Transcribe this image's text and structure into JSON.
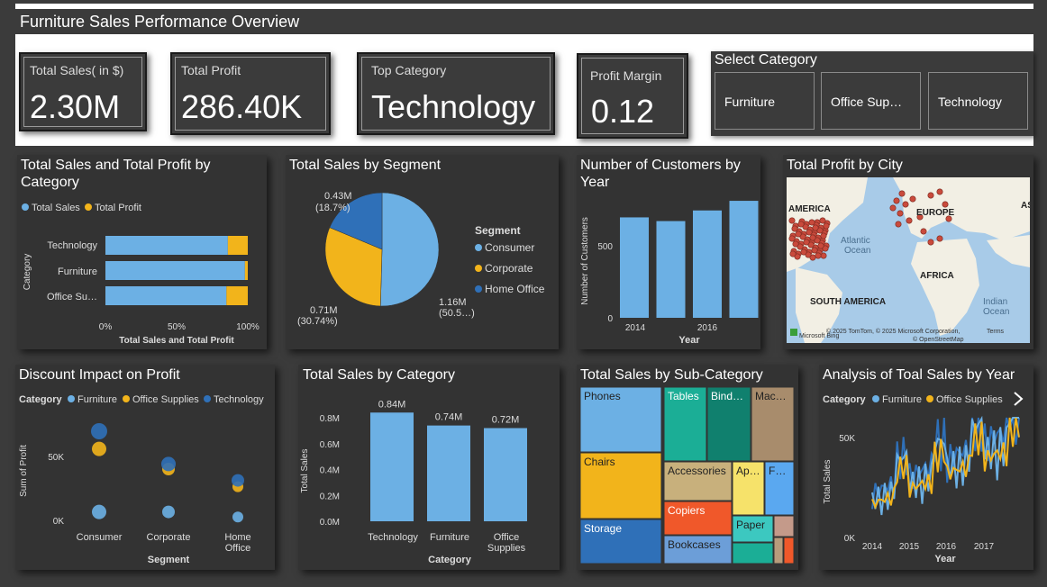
{
  "header": {
    "title": "Furniture Sales Performance Overview"
  },
  "kpis": {
    "total_sales": {
      "label": "Total Sales( in $)",
      "value": "2.30M"
    },
    "total_profit": {
      "label": "Total Profit",
      "value": "286.40K"
    },
    "top_category": {
      "label": "Top Category",
      "value": "Technology"
    },
    "profit_margin": {
      "label": "Profit Margin",
      "value": "0.12"
    }
  },
  "slicer": {
    "title": "Select Category",
    "options": [
      "Furniture",
      "Office Sup…",
      "Technology"
    ]
  },
  "colors": {
    "light_blue": "#6cb0e4",
    "gold": "#f2b41b",
    "dark_blue": "#2f70b8",
    "bg": "#3b3b3b"
  },
  "panels": {
    "sales_profit_category": {
      "title": "Total Sales and Total Profit by Category",
      "legend": [
        "Total Sales",
        "Total Profit"
      ],
      "ylabel": "Category",
      "xlabel": "Total Sales and Total Profit",
      "categories": [
        "Technology",
        "Furniture",
        "Office Su…"
      ],
      "ticks": [
        "0%",
        "50%",
        "100%"
      ]
    },
    "segment_pie": {
      "title": "Total Sales by Segment",
      "legend_title": "Segment",
      "legend": [
        "Consumer",
        "Corporate",
        "Home Office"
      ],
      "labels": {
        "consumer": "1.16M",
        "consumer_pct": "(50.5…)",
        "corporate": "0.71M",
        "corporate_pct": "(30.74%)",
        "home": "0.43M",
        "home_pct": "(18.7%)"
      }
    },
    "customers_year": {
      "title": "Number of Customers by Year",
      "ylabel": "Number of Customers",
      "xlabel": "Year",
      "yticks": [
        "0",
        "500"
      ],
      "xticks": [
        "2014",
        "2016"
      ]
    },
    "profit_city": {
      "title": "Total Profit by City",
      "labels": {
        "america": "AMERICA",
        "europe": "EUROPE",
        "as": "AS",
        "atlantic": "Atlantic",
        "ocean": "Ocean",
        "africa": "AFRICA",
        "south_america": "SOUTH AMERICA",
        "indian": "Indian",
        "ocean2": "Ocean"
      },
      "attribution": "© 2025 TomTom, © 2025 Microsoft Corporation,",
      "osm": "© OpenStreetMap",
      "terms": "Terms",
      "bing": "Microsoft Bing"
    },
    "discount": {
      "title": "Discount Impact on Profit",
      "legend_title": "Category",
      "legend": [
        "Furniture",
        "Office Supplies",
        "Technology"
      ],
      "ylabel": "Sum of Profit",
      "xlabel": "Segment",
      "yticks": [
        "0K",
        "50K"
      ],
      "xticks": [
        "Consumer",
        "Corporate",
        "Home",
        "Office"
      ]
    },
    "sales_category": {
      "title": "Total Sales by Category",
      "ylabel": "Total Sales",
      "xlabel": "Category",
      "yticks": [
        "0.0M",
        "0.2M",
        "0.4M",
        "0.6M",
        "0.8M"
      ],
      "xticks": [
        "Technology",
        "Furniture",
        "Office",
        "Supplies"
      ]
    },
    "subcategory": {
      "title": "Total Sales by Sub-Category",
      "tiles": [
        "Phones",
        "Tables",
        "Bind…",
        "Mac…",
        "Chairs",
        "Accessories",
        "Ap…",
        "F…",
        "Storage",
        "Copiers",
        "Paper",
        "Bookcases"
      ]
    },
    "year_analysis": {
      "title": "Analysis of Toal Sales by Year",
      "legend_title": "Category",
      "legend": [
        "Furniture",
        "Office Supplies"
      ],
      "ylabel": "Total Sales",
      "xlabel": "Year",
      "yticks": [
        "0K",
        "50K"
      ],
      "xticks": [
        "2014",
        "2015",
        "2016",
        "2017"
      ]
    }
  },
  "chart_data": [
    {
      "type": "bar",
      "title": "Total Sales and Total Profit by Category",
      "categories": [
        "Technology",
        "Furniture",
        "Office Su…"
      ],
      "series": [
        {
          "name": "Total Sales",
          "values": [
            86,
            98,
            85
          ]
        },
        {
          "name": "Total Profit",
          "values": [
            14,
            2,
            15
          ]
        }
      ],
      "xlabel": "Total Sales and Total Profit",
      "ylabel": "Category",
      "xlim": [
        0,
        100
      ]
    },
    {
      "type": "pie",
      "title": "Total Sales by Segment",
      "categories": [
        "Consumer",
        "Corporate",
        "Home Office"
      ],
      "values": [
        1.16,
        0.71,
        0.43
      ]
    },
    {
      "type": "bar",
      "title": "Number of Customers by Year",
      "categories": [
        "2014",
        "2015",
        "2016",
        "2017"
      ],
      "values": [
        595,
        573,
        636,
        693
      ],
      "ylabel": "Number of Customers",
      "xlabel": "Year"
    },
    {
      "type": "scatter",
      "title": "Discount Impact on Profit",
      "categories": [
        "Consumer",
        "Corporate",
        "Home Office"
      ],
      "series": [
        {
          "name": "Furniture",
          "values": [
            6,
            6,
            2
          ]
        },
        {
          "name": "Office Supplies",
          "values": [
            56,
            40,
            26
          ]
        },
        {
          "name": "Technology",
          "values": [
            70,
            44,
            31
          ]
        }
      ],
      "ylabel": "Sum of Profit",
      "xlabel": "Segment"
    },
    {
      "type": "bar",
      "title": "Total Sales by Category",
      "categories": [
        "Technology",
        "Furniture",
        "Office Supplies"
      ],
      "values": [
        0.84,
        0.74,
        0.72
      ],
      "ylim": [
        0,
        0.8
      ],
      "ylabel": "Total Sales",
      "xlabel": "Category"
    },
    {
      "type": "line",
      "title": "Analysis of Toal Sales by Year",
      "x": [
        "2014",
        "2015",
        "2016",
        "2017"
      ],
      "ylabel": "Total Sales",
      "xlabel": "Year"
    }
  ]
}
